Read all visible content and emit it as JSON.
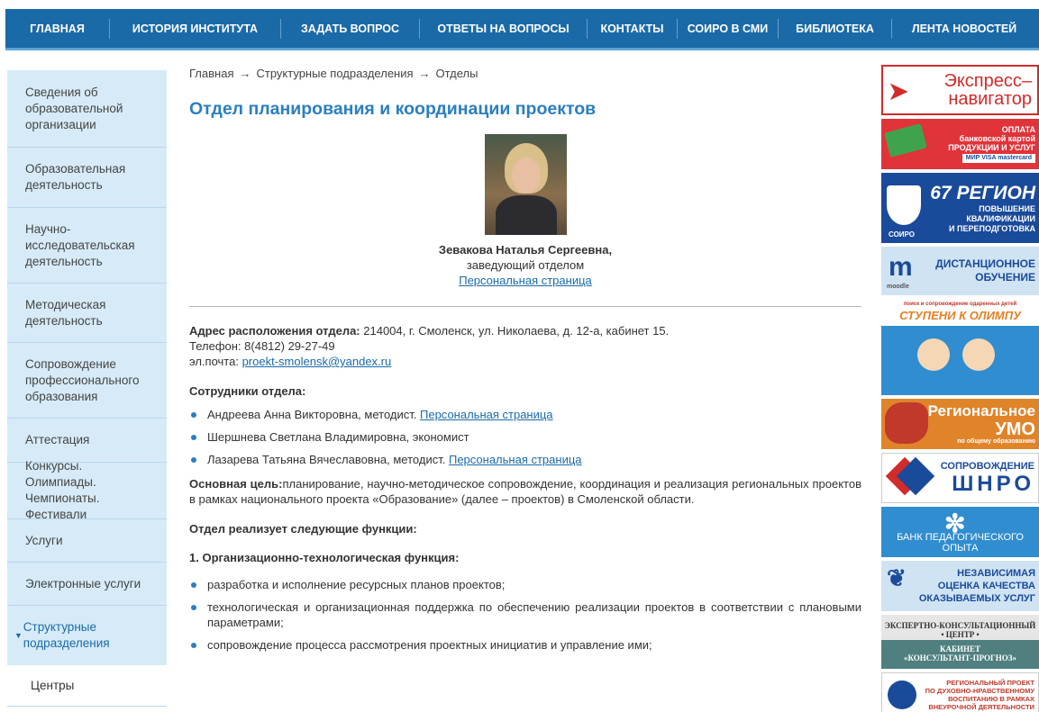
{
  "topnav": {
    "items": [
      "ГЛАВНАЯ",
      "ИСТОРИЯ ИНСТИТУТА",
      "ЗАДАТЬ ВОПРОС",
      "ОТВЕТЫ НА ВОПРОСЫ",
      "КОНТАКТЫ",
      "СОИРО В СМИ",
      "БИБЛИОТЕКА",
      "ЛЕНТА НОВОСТЕЙ"
    ]
  },
  "sidebar": {
    "items": [
      "Сведения об образовательной организации",
      "Образовательная деятельность",
      "Научно-исследовательская деятельность",
      "Методическая деятельность",
      "Сопровождение профессионального образования",
      "Аттестация",
      "Конкурсы. Олимпиады. Чемпионаты. Фестивали",
      "Услуги",
      "Электронные услуги",
      "Структурные подразделения"
    ],
    "subitems": [
      "Центры"
    ]
  },
  "breadcrumb": {
    "home": "Главная",
    "section": "Структурные подразделения",
    "current": "Отделы",
    "sep": "→"
  },
  "page": {
    "title": "Отдел планирования и координации проектов"
  },
  "profile": {
    "name": "Зевакова Наталья Сергеевна,",
    "position": "заведующий отделом",
    "link": "Персональная страница"
  },
  "contacts": {
    "address_label": "Адрес расположения отдела:",
    "address": " 214004, г. Смоленск, ул. Николаева, д. 12-а, кабинет 15.",
    "phone": "Телефон: 8(4812) 29-27-49",
    "email_label": "эл.почта: ",
    "email": "proekt-smolensk@yandex.ru"
  },
  "staff": {
    "heading": "Сотрудники отдела:",
    "members": [
      {
        "text": "Андреева Анна Викторовна, методист.",
        "link": "Персональная страница"
      },
      {
        "text": "Шершнева Светлана Владимировна, экономист",
        "link": ""
      },
      {
        "text": "Лазарева Татьяна Вячеславовна, методист.",
        "link": "Персональная страница"
      }
    ]
  },
  "goal": {
    "label": "Основная цель:",
    "text": "планирование, научно-методическое сопровождение, координация и реализация региональных проектов в рамках национального проекта «Образование» (далее – проектов) в Смоленской области."
  },
  "functions": {
    "heading": "Отдел реализует следующие функции:",
    "sub_heading": "1. Организационно-технологическая функция:",
    "items": [
      "разработка и исполнение ресурсных планов проектов;",
      "технологическая и организационная поддержка по обеспечению реализации проектов в соответствии с плановыми параметрами;",
      "сопровождение процесса рассмотрения проектных инициатив и управление ими;"
    ]
  },
  "banners": [
    {
      "line1": "Экспресс–",
      "line2": "навигатор"
    },
    {
      "line1": "ОПЛАТА",
      "line2": "банковской картой",
      "line3": "ПРОДУКЦИИ И УСЛУГ",
      "line4": "МИР VISA mastercard"
    },
    {
      "line1": "67 РЕГИОН",
      "line2": "ПОВЫШЕНИЕ",
      "line3": "КВАЛИФИКАЦИИ",
      "line4": "И ПЕРЕПОДГОТОВКА",
      "line5": "СОИРО"
    },
    {
      "line1": "ДИСТАНЦИОННОЕ",
      "line2": "ОБУЧЕНИЕ",
      "line3": "moodle"
    },
    {
      "line1": "поиск и сопровождение одаренных детей",
      "line2": "СТУПЕНИ К ОЛИМПУ"
    },
    {
      "line1": "Региональное",
      "line2": "УМО",
      "line3": "по общему образованию"
    },
    {
      "line1": "СОПРОВОЖДЕНИЕ",
      "line2": "ШНРО"
    },
    {
      "line1": "БАНК ПЕДАГОГИЧЕСКОГО ОПЫТА"
    },
    {
      "line1": "НЕЗАВИСИМАЯ",
      "line2": "ОЦЕНКА КАЧЕСТВА",
      "line3": "ОКАЗЫВАЕМЫХ УСЛУГ"
    },
    {
      "line1": "ЭКСПЕРТНО-КОНСУЛЬТАЦИОННЫЙ",
      "line2": "• ЦЕНТР •",
      "line3": "КАБИНЕТ",
      "line4": "«КОНСУЛЬТАНТ-ПРОГНОЗ»"
    },
    {
      "line1": "РЕГИОНАЛЬНЫЙ ПРОЕКТ",
      "line2": "ПО ДУХОВНО-НРАВСТВЕННОМУ",
      "line3": "ВОСПИТАНИЮ В РАМКАХ",
      "line4": "ВНЕУРОЧНОЙ ДЕЯТЕЛЬНОСТИ"
    }
  ],
  "colors": {
    "nav_bg": "#1a6aa8",
    "title": "#2a7fc0",
    "sidebar_bg": "#d6ebf7"
  }
}
